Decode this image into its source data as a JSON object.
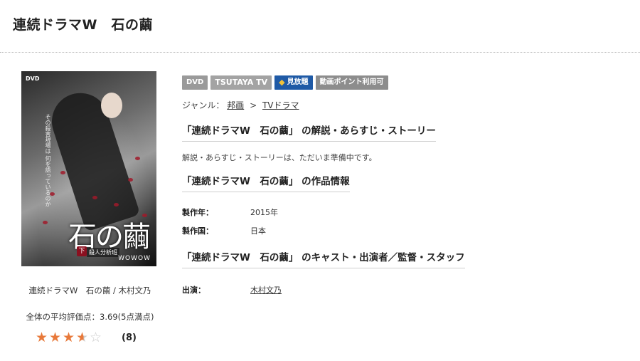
{
  "page": {
    "title": "連続ドラマW　石の繭"
  },
  "cover": {
    "dvd_mark": "DVD",
    "title_art": "石の繭",
    "volume": "下",
    "subtitle": "殺人分析班",
    "brand": "WOWOW",
    "tagline": "その殺害現場は 何を語っているのか"
  },
  "item": {
    "caption": "連続ドラマW　石の繭 / 木村文乃",
    "average_label": "全体の平均評価点：3.69(5点満点)",
    "rating": 3.69,
    "rating_max": 5,
    "review_count": "(8)"
  },
  "badges": {
    "dvd": "DVD",
    "tsutaya": "TSUTAYA TV",
    "mihoudai": "見放題",
    "points": "動画ポイント利用可"
  },
  "genre": {
    "label": "ジャンル：",
    "main": "邦画",
    "separator": ">",
    "sub": "TVドラマ"
  },
  "sections": {
    "story_heading": "「連続ドラマW　石の繭」 の解説・あらすじ・ストーリー",
    "story_text": "解説・あらすじ・ストーリーは、ただいま準備中です。",
    "info_heading": "「連続ドラマW　石の繭」 の作品情報",
    "year_label": "製作年：",
    "year_value": "2015年",
    "country_label": "製作国：",
    "country_value": "日本",
    "cast_heading": "「連続ドラマW　石の繭」 のキャスト・出演者／監督・スタッフ",
    "cast_label": "出演：",
    "cast_value": "木村文乃"
  },
  "colors": {
    "star": "#e8793a",
    "star_empty": "#cccccc",
    "mihoudai_badge": "#1f5aa6",
    "gray_badge": "#9a9a9a"
  },
  "icons": {
    "mihoudai": "diamond-icon",
    "star": "star-icon"
  }
}
